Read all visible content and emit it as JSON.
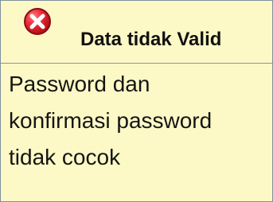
{
  "dialog": {
    "title": "Data tidak Valid",
    "icon": "error-x-icon",
    "message": "Password dan konfirmasi password tidak cocok"
  },
  "colors": {
    "background": "#fdf9c6",
    "border": "#7e8f9c",
    "icon_red": "#e01b24",
    "text": "#151515"
  }
}
